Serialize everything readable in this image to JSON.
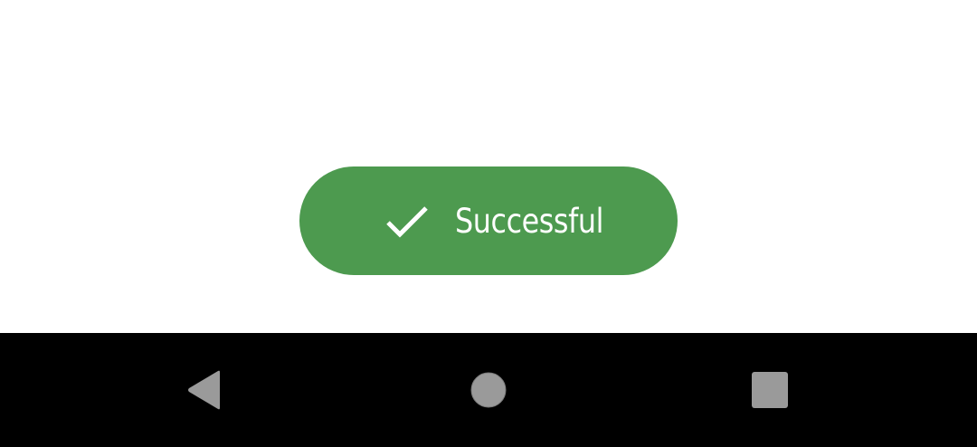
{
  "toast": {
    "message": "Successful",
    "background_color": "#4d9a4f",
    "text_color": "#ffffff",
    "icon": "checkmark-icon"
  },
  "navigation_bar": {
    "background_color": "#000000",
    "button_color": "#9a9a9a",
    "buttons": [
      {
        "name": "back",
        "icon": "back-triangle-icon"
      },
      {
        "name": "home",
        "icon": "home-circle-icon"
      },
      {
        "name": "recents",
        "icon": "recents-square-icon"
      }
    ]
  }
}
